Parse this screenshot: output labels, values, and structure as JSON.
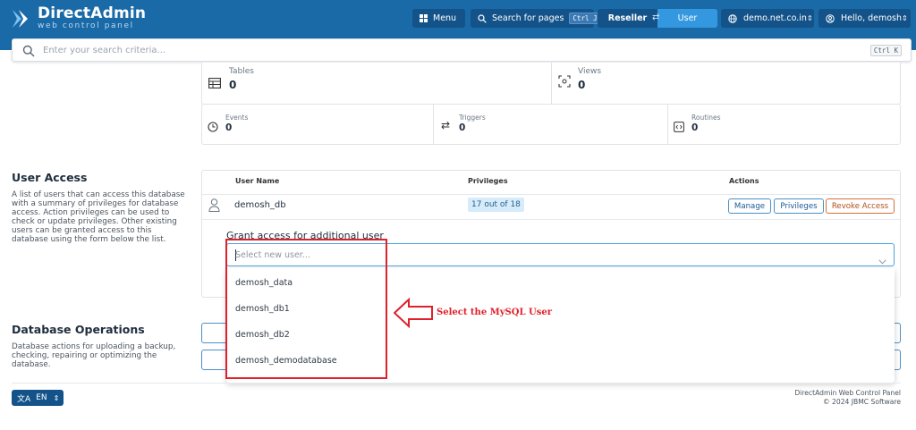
{
  "app": {
    "logo_title": "DirectAdmin",
    "logo_sub": "web control panel"
  },
  "topbar": {
    "menu_label": "Menu",
    "search_label": "Search for pages",
    "search_shortcut": "Ctrl J",
    "reseller_label": "Reseller",
    "user_label": "User",
    "domain_label": "demo.net.co.in",
    "greeting_label": "Hello, demosh",
    "icons": [
      "grid-icon",
      "search-icon",
      "swap-icon",
      "globe-icon",
      "user-circle-icon",
      "chevron-updown-icon"
    ]
  },
  "search": {
    "placeholder": "Enter your search criteria...",
    "shortcut": "Ctrl K"
  },
  "stats": {
    "tables_label": "Tables",
    "tables_value": "0",
    "views_label": "Views",
    "views_value": "0",
    "events_label": "Events",
    "events_value": "0",
    "triggers_label": "Triggers",
    "triggers_value": "0",
    "routines_label": "Routines",
    "routines_value": "0"
  },
  "user_access": {
    "title": "User Access",
    "description": "A list of users that can access this database with a summary of privileges for database access. Action privileges can be used to check or update privileges. Other existing users can be granted access to this database using the form below the list.",
    "columns": {
      "user_name": "User Name",
      "privileges": "Privileges",
      "actions": "Actions"
    },
    "row": {
      "user_name": "demosh_db",
      "privileges": "17 out of 18",
      "manage": "Manage",
      "privileges_btn": "Privileges",
      "revoke": "Revoke Access"
    },
    "grant_label": "Grant access for additional user",
    "select_placeholder": "Select new user...",
    "options": [
      "demosh_data",
      "demosh_db1",
      "demosh_db2",
      "demosh_demodatabase"
    ]
  },
  "annotation": {
    "text": "Select the MySQL User",
    "color": "#e0202a"
  },
  "db_operations": {
    "title": "Database Operations",
    "description": "Database actions for uploading a backup, checking, repairing or optimizing the database."
  },
  "footer": {
    "lang_label": "EN",
    "product": "DirectAdmin Web Control Panel",
    "copyright": "© 2024 JBMC Software"
  },
  "colors": {
    "topbar": "#1a6aa8",
    "button_dark": "#135389",
    "accent": "#3498e0",
    "danger": "#d5703a"
  }
}
